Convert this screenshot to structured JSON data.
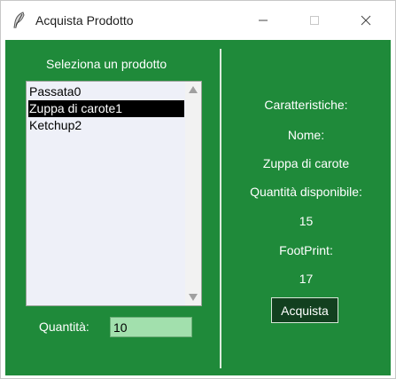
{
  "window": {
    "title": "Acquista Prodotto",
    "icon": "feather-icon"
  },
  "left": {
    "select_label": "Seleziona un prodotto",
    "products": [
      {
        "label": "Passata0",
        "selected": false
      },
      {
        "label": "Zuppa di carote1",
        "selected": true
      },
      {
        "label": "Ketchup2",
        "selected": false
      }
    ],
    "quantity_label": "Quantità:",
    "quantity_value": "10"
  },
  "right": {
    "features_label": "Caratteristiche:",
    "name_label": "Nome:",
    "name_value": "Zuppa di carote",
    "available_label": "Quantità disponibile:",
    "available_value": "15",
    "footprint_label": "FootPrint:",
    "footprint_value": "17",
    "buy_label": "Acquista"
  },
  "colors": {
    "background": "#1f8a3a",
    "selection": "#000000",
    "quantity_field": "#a2e0ad",
    "buy_button": "#12401f"
  }
}
